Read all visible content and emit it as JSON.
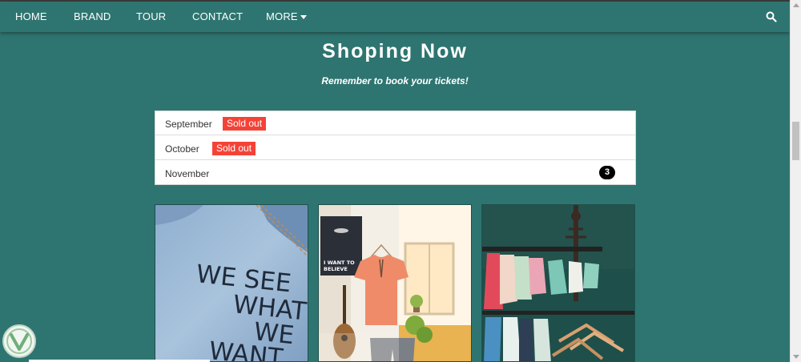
{
  "nav": {
    "items": [
      {
        "label": "HOME"
      },
      {
        "label": "BRAND"
      },
      {
        "label": "TOUR"
      },
      {
        "label": "CONTACT"
      },
      {
        "label": "MORE"
      }
    ]
  },
  "page": {
    "title": "Shoping Now",
    "subtitle": "Remember to book your tickets!"
  },
  "months": [
    {
      "label": "September",
      "badge": "Sold out"
    },
    {
      "label": "October",
      "badge": "Sold out"
    },
    {
      "label": "November",
      "count": "3"
    }
  ],
  "products": {
    "jacket_text": [
      "WE SEE",
      "WHAT",
      "WE",
      "WANT"
    ],
    "poster_text": [
      "I WANT TO",
      "BELIEVE"
    ]
  },
  "colors": {
    "background": "#2e7571",
    "badge_red": "#f44336",
    "white": "#ffffff"
  },
  "icons": {
    "search": "search-icon",
    "more": "caret-down-icon",
    "logo": "brand-logo"
  }
}
